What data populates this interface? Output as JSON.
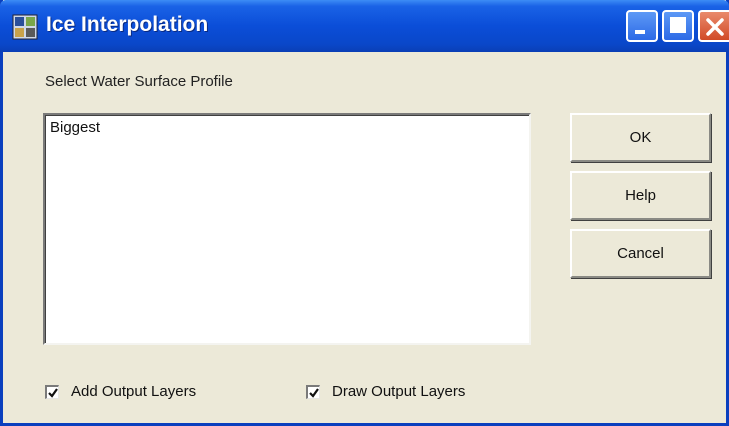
{
  "window": {
    "title": "Ice Interpolation",
    "icon": "arcgis-tool-icon",
    "controls": [
      "minimize-icon",
      "maximize-icon",
      "close-icon"
    ]
  },
  "profile": {
    "label": "Select Water Surface Profile",
    "items": [
      "Biggest"
    ]
  },
  "buttons": {
    "ok": "OK",
    "help": "Help",
    "cancel": "Cancel"
  },
  "options": {
    "add_output_layers": {
      "label": "Add Output Layers",
      "checked": true
    },
    "draw_output_layers": {
      "label": "Draw Output Layers",
      "checked": true
    }
  },
  "colors": {
    "titlebar": "#0b4ed8",
    "dialog_bg": "#ece9d8",
    "close_button": "#d14a27"
  }
}
